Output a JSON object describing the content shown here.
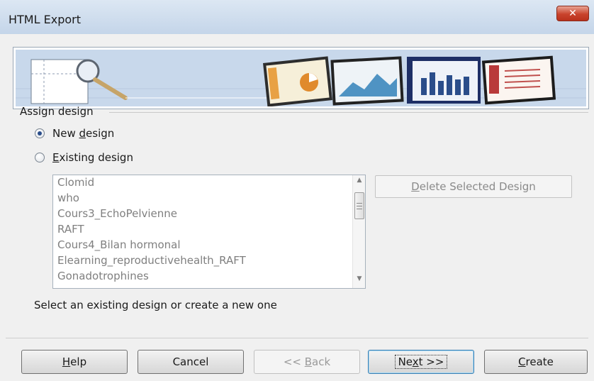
{
  "window": {
    "title": "HTML Export",
    "close_glyph": "✕"
  },
  "assign_design": {
    "group_label": "Assign design",
    "new_design": {
      "label_pre": "New ",
      "accel": "d",
      "label_post": "esign",
      "checked": true
    },
    "existing_design": {
      "label_pre": "",
      "accel": "E",
      "label_post": "xisting design",
      "checked": false
    },
    "designs": [
      "Clomid",
      "who",
      "Cours3_EchoPelvienne",
      "RAFT",
      "Cours4_Bilan hormonal",
      "Elearning_reproductivehealth_RAFT",
      "Gonadotrophines"
    ],
    "delete_button": {
      "label_pre": "",
      "accel": "D",
      "label_post": "elete Selected Design"
    },
    "hint": "Select an existing design or create a new one"
  },
  "buttons": {
    "help": {
      "label_pre": "",
      "accel": "H",
      "label_post": "elp"
    },
    "cancel": {
      "label": "Cancel"
    },
    "back": {
      "label_pre": "<< ",
      "accel": "B",
      "label_post": "ack"
    },
    "next": {
      "label_pre": "Ne",
      "accel": "x",
      "label_post": "t >>"
    },
    "create": {
      "label_pre": "",
      "accel": "C",
      "label_post": "reate"
    }
  },
  "icons": {
    "close": "close-icon",
    "banner_magnifier": "magnifier-icon",
    "scroll_up": "scroll-up-arrow-icon",
    "scroll_down": "scroll-down-arrow-icon"
  },
  "colors": {
    "banner_bg": "#c8d8eb",
    "accent_blue": "#2a4d8a",
    "close_red": "#c9432c"
  }
}
